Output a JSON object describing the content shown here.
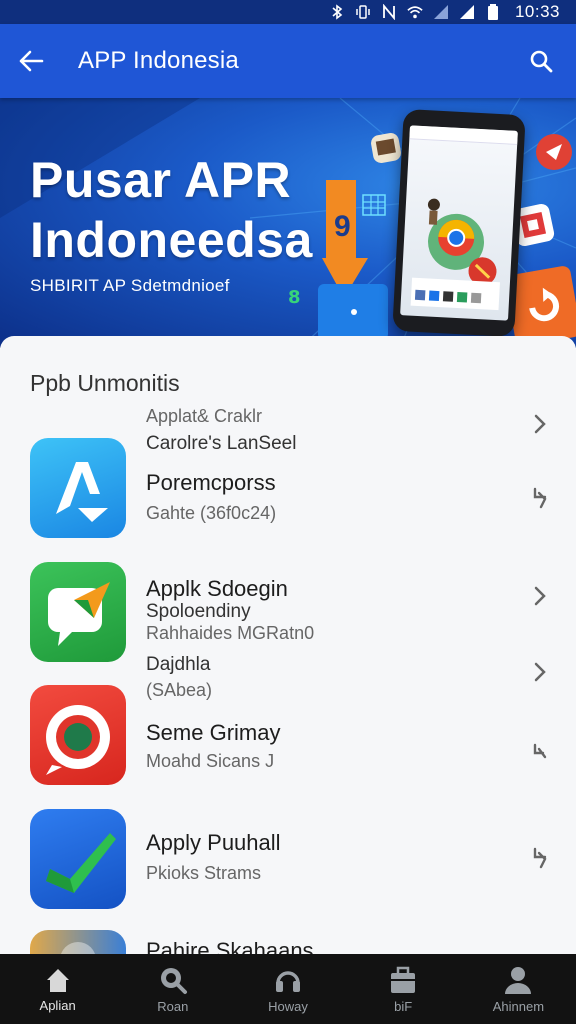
{
  "status_bar": {
    "time": "10:33",
    "icons": [
      "bluetooth-icon",
      "vibrate-icon",
      "nfc-icon",
      "wifi-icon",
      "signal-icon",
      "signal-icon",
      "battery-icon"
    ]
  },
  "app_bar": {
    "title": "APP Indonesia",
    "back_icon": "arrow-left-icon",
    "search_icon": "search-icon"
  },
  "banner": {
    "title_line1": "Pusar APR",
    "title_line2": "Indoneedsa",
    "subtitle": "SHBIRIT AP Sdetmdnioef"
  },
  "section": {
    "title": "Ppb Unmonitis"
  },
  "list_text": {
    "line1": "Applat& Craklr",
    "line2": "Carolre's LanSeel",
    "line3": "Poremcporss",
    "line4": "Gahte (36f0c24)",
    "line5": "Applk Sdoegin",
    "line6": "Spoloendiny",
    "line7": "Rahhaides MGRatn0",
    "line8": "Dajdhla",
    "line9": "(SAbea)",
    "line10": "Seme Grimay",
    "line11": "Moahd Sicans J",
    "line12": "Apply Puuhall",
    "line13": "Pkioks Strams",
    "line14": "Pahire Skahaans"
  },
  "bottom_nav": [
    {
      "label": "Aplian",
      "icon": "home-icon"
    },
    {
      "label": "Roan",
      "icon": "search-icon"
    },
    {
      "label": "Howay",
      "icon": "headset-icon"
    },
    {
      "label": "biF",
      "icon": "briefcase-icon"
    },
    {
      "label": "Ahinnem",
      "icon": "person-icon"
    }
  ],
  "colors": {
    "app_bar": "#1f56d6",
    "status_bar": "#0f2f7e",
    "nav_bar": "#121212"
  }
}
